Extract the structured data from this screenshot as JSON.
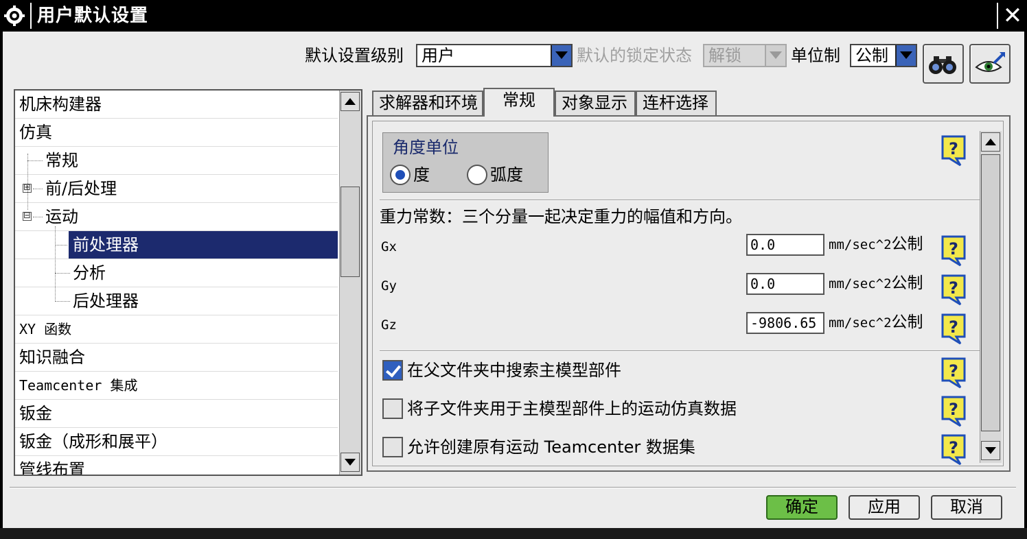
{
  "window": {
    "title": "用户默认设置",
    "close_glyph": "✕"
  },
  "topbar": {
    "level_label": "默认设置级别",
    "level_value": "用户",
    "lock_label": "默认的锁定状态",
    "lock_value": "解锁",
    "unit_label": "单位制",
    "unit_value": "公制",
    "icons": [
      "binoculars-icon",
      "eye-arrow-icon"
    ]
  },
  "tree": {
    "items": [
      {
        "label": "机床构建器",
        "level": 0
      },
      {
        "label": "仿真",
        "level": 0
      },
      {
        "label": "常规",
        "level": 1
      },
      {
        "label": "前/后处理",
        "level": 1,
        "expander": "⊞"
      },
      {
        "label": "运动",
        "level": 1,
        "expander": "⊟"
      },
      {
        "label": "前处理器",
        "level": 2,
        "selected": true
      },
      {
        "label": "分析",
        "level": 2
      },
      {
        "label": "后处理器",
        "level": 2
      },
      {
        "label": "XY 函数",
        "level": 0
      },
      {
        "label": "知识融合",
        "level": 0
      },
      {
        "label": "Teamcenter 集成",
        "level": 0
      },
      {
        "label": "钣金",
        "level": 0
      },
      {
        "label": "钣金（成形和展平）",
        "level": 0
      },
      {
        "label": "管线布置",
        "level": 0
      }
    ]
  },
  "tabs": [
    {
      "label": "求解器和环境",
      "active": false
    },
    {
      "label": "常规",
      "active": true
    },
    {
      "label": "对象显示",
      "active": false
    },
    {
      "label": "连杆选择",
      "active": false
    }
  ],
  "panel": {
    "angle_group_title": "角度单位",
    "radio_degree": "度",
    "radio_radian": "弧度",
    "radio_selected": "degree",
    "gravity_desc": "重力常数：三个分量一起决定重力的幅值和方向。",
    "gravity": [
      {
        "label": "Gx",
        "value": "0.0",
        "unit": "mm/sec^2",
        "unit_cn": "公制"
      },
      {
        "label": "Gy",
        "value": "0.0",
        "unit": "mm/sec^2",
        "unit_cn": "公制"
      },
      {
        "label": "Gz",
        "value": "-9806.65",
        "unit": "mm/sec^2",
        "unit_cn": "公制"
      }
    ],
    "options": [
      {
        "label": "在父文件夹中搜索主模型部件",
        "checked": true
      },
      {
        "label": "将子文件夹用于主模型部件上的运动仿真数据",
        "checked": false
      },
      {
        "label": "允许创建原有运动 Teamcenter 数据集",
        "checked": false
      }
    ],
    "help_glyph": "?"
  },
  "buttons": {
    "ok": "确定",
    "apply": "应用",
    "cancel": "取消"
  },
  "colors": {
    "selection": "#1c2a6e",
    "accent_blue": "#3a63b8",
    "ok_green": "#6cbf47",
    "help_yellow": "#f3e84a"
  }
}
